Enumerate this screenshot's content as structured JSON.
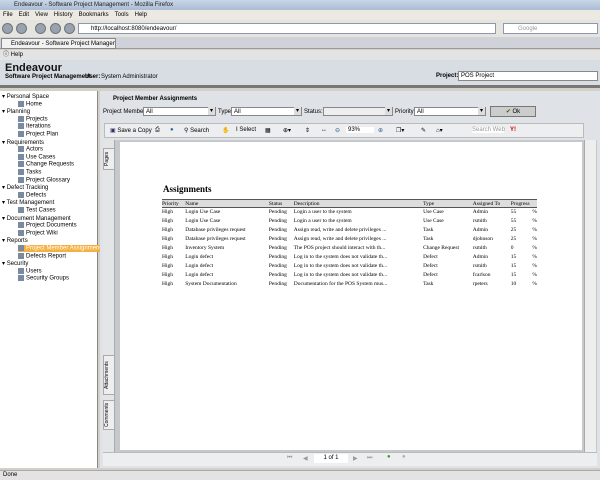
{
  "window": {
    "title": "Endeavour - Software Project Management - Mozilla Firefox"
  },
  "menu": [
    "File",
    "Edit",
    "View",
    "History",
    "Bookmarks",
    "Tools",
    "Help"
  ],
  "url": "http://localhost:8080/endeavour/",
  "search_placeholder": "Google",
  "tab": "Endeavour - Software Project Managem...",
  "help": "Help",
  "header": {
    "title": "Endeavour",
    "subtitle": "Software Project Management",
    "user_label": "User:",
    "user": "System Administrator",
    "project_label": "Project:",
    "project": "POS Project"
  },
  "sidebar": [
    {
      "group": "Personal Space",
      "items": [
        "Home"
      ]
    },
    {
      "group": "Planning",
      "items": [
        "Projects",
        "Iterations",
        "Project Plan"
      ]
    },
    {
      "group": "Requirements",
      "items": [
        "Actors",
        "Use Cases",
        "Change Requests",
        "Tasks",
        "Project Glossary"
      ]
    },
    {
      "group": "Defect Tracking",
      "items": [
        "Defects"
      ]
    },
    {
      "group": "Test Management",
      "items": [
        "Test Cases"
      ]
    },
    {
      "group": "Document Management",
      "items": [
        "Project Documents",
        "Project Wiki"
      ]
    },
    {
      "group": "Reports",
      "items": [
        "Project Member Assignments",
        "Defects Report"
      ]
    },
    {
      "group": "Security",
      "items": [
        "Users",
        "Security Groups"
      ]
    }
  ],
  "panel": {
    "title": "Project Member Assignments",
    "filters": {
      "member_label": "Project Member:",
      "member": "All",
      "type_label": "Type:",
      "type": "All",
      "status_label": "Status:",
      "status": "",
      "priority_label": "Priority:",
      "priority": "All",
      "ok": "Ok"
    }
  },
  "pdf": {
    "save": "Save a Copy",
    "search": "Search",
    "select": "Select",
    "zoom": "93%",
    "search_web": "Search Web",
    "tabs": [
      "Pages",
      "Attachments",
      "Comments"
    ],
    "page": "1 of 1"
  },
  "report": {
    "title": "Assignments",
    "columns": [
      "Priority",
      "Name",
      "Status",
      "Description",
      "Type",
      "Assigned To",
      "Progress"
    ],
    "rows": [
      [
        "High",
        "Login Use Case",
        "Pending",
        "Login a user to the system",
        "Use Case",
        "Admin",
        "55",
        "%"
      ],
      [
        "High",
        "Login Use Case",
        "Pending",
        "Login a user to the system",
        "Use Case",
        "rsmith",
        "55",
        "%"
      ],
      [
        "High",
        "Database privileges request",
        "Pending",
        "Assign read, write and delete privileges ...",
        "Task",
        "Admin",
        "25",
        "%"
      ],
      [
        "High",
        "Database privileges request",
        "Pending",
        "Assign read, write and delete privileges ...",
        "Task",
        "djohnson",
        "25",
        "%"
      ],
      [
        "High",
        "Inventory System",
        "Pending",
        "The POS project should interact with th...",
        "Change Request",
        "rsmith",
        "0",
        "%"
      ],
      [
        "High",
        "Login defect",
        "Pending",
        "Log in to the system does not validate th...",
        "Defect",
        "Admin",
        "15",
        "%"
      ],
      [
        "High",
        "Login defect",
        "Pending",
        "Log in to the system does not validate th...",
        "Defect",
        "rsmith",
        "15",
        "%"
      ],
      [
        "High",
        "Login defect",
        "Pending",
        "Log in to the system does not validate th...",
        "Defect",
        "fcarlson",
        "15",
        "%"
      ],
      [
        "High",
        "System Documentation",
        "Pending",
        "Documentation for the POS System mus...",
        "Task",
        "rpeters",
        "10",
        "%"
      ]
    ]
  },
  "status": "Done"
}
